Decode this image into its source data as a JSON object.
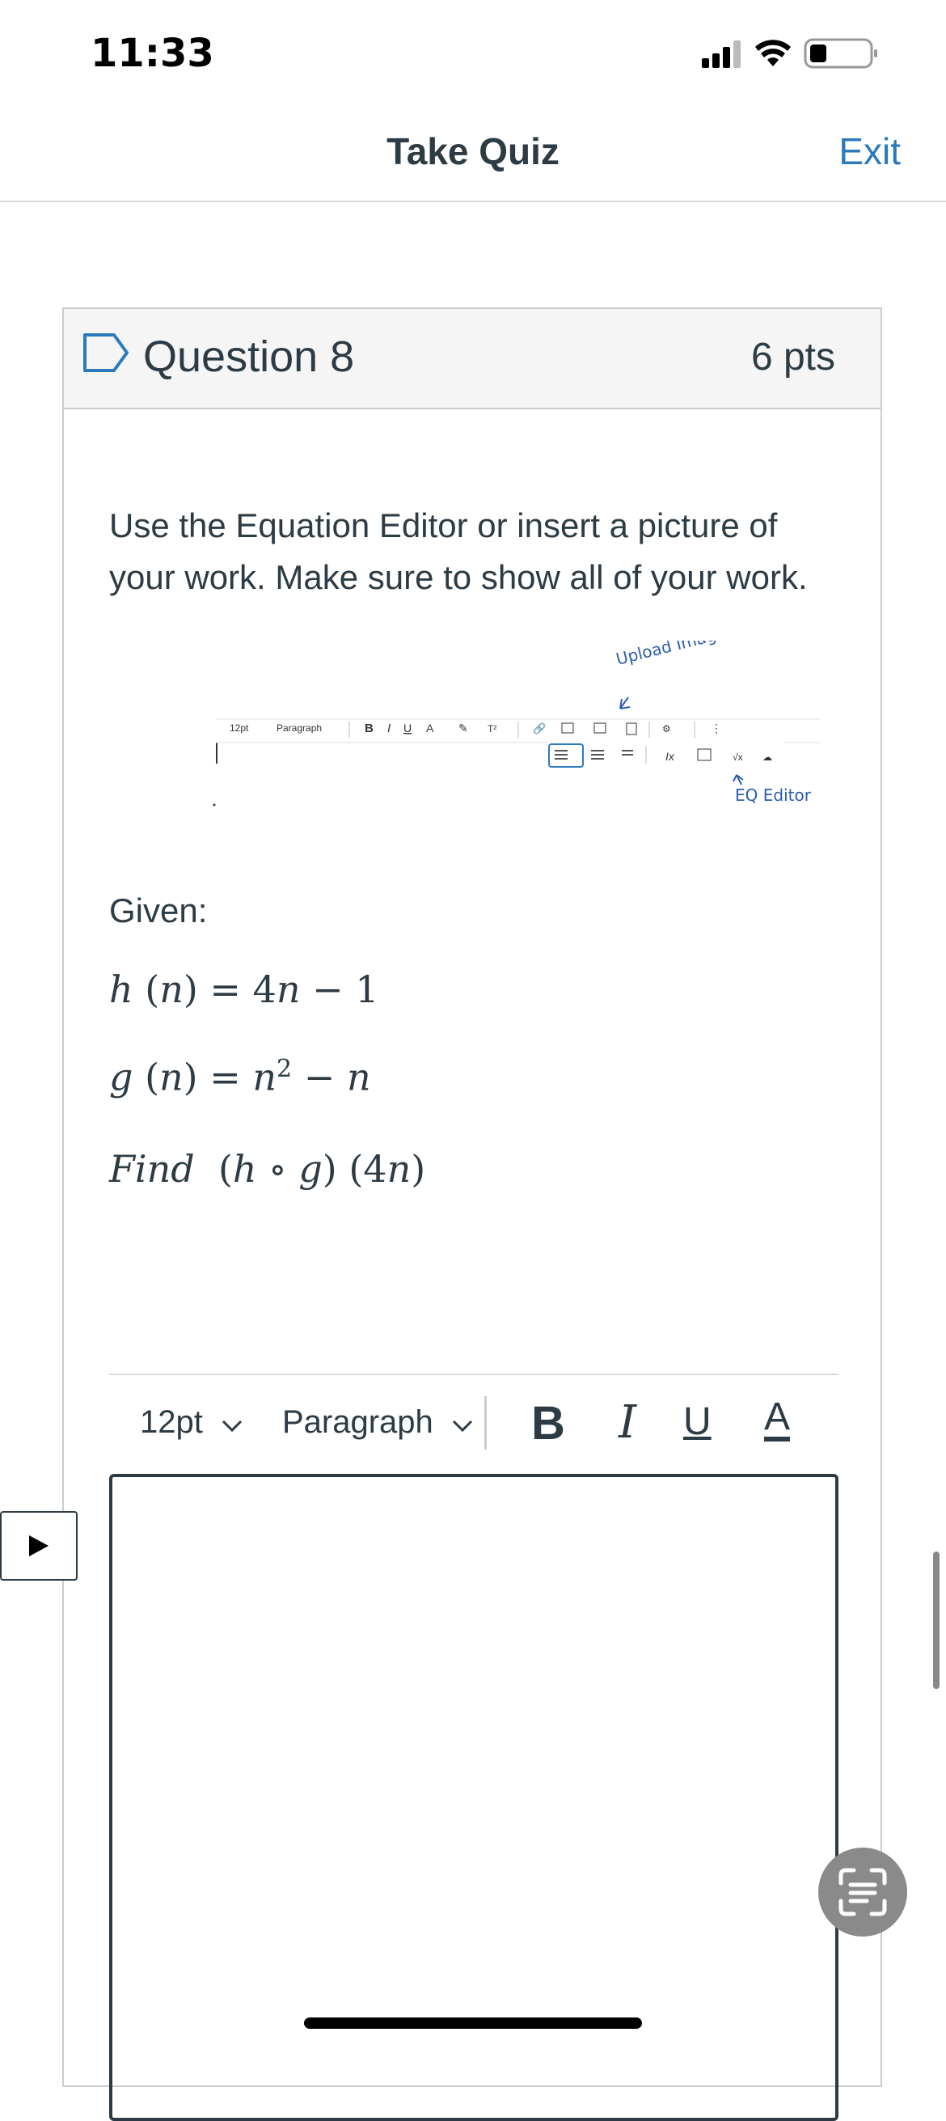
{
  "status_bar": {
    "time": "11:33"
  },
  "header": {
    "title": "Take Quiz",
    "exit_label": "Exit"
  },
  "question": {
    "title": "Question 8",
    "points": "6 pts",
    "instructions": "Use the Equation Editor or insert a picture of your work.  Make sure to show all of your work.",
    "toolbar_image": {
      "font_size": "12pt",
      "block_format": "Paragraph",
      "annotation_upload": "Upload Image",
      "annotation_eq": "EQ Editor"
    },
    "given_label": "Given:",
    "equations": {
      "h": "h (n) = 4n − 1",
      "g": "g (n) = n² − n",
      "find": "Find  (h ∘ g) (4n)"
    }
  },
  "editor": {
    "font_size": "12pt",
    "block_format": "Paragraph",
    "bold": "B",
    "italic": "I",
    "underline": "U",
    "text_color": "A"
  },
  "colors": {
    "accent": "#2b7abc",
    "text": "#2d3b45",
    "border": "#c7cdd1",
    "header_bg": "#f5f5f5"
  }
}
